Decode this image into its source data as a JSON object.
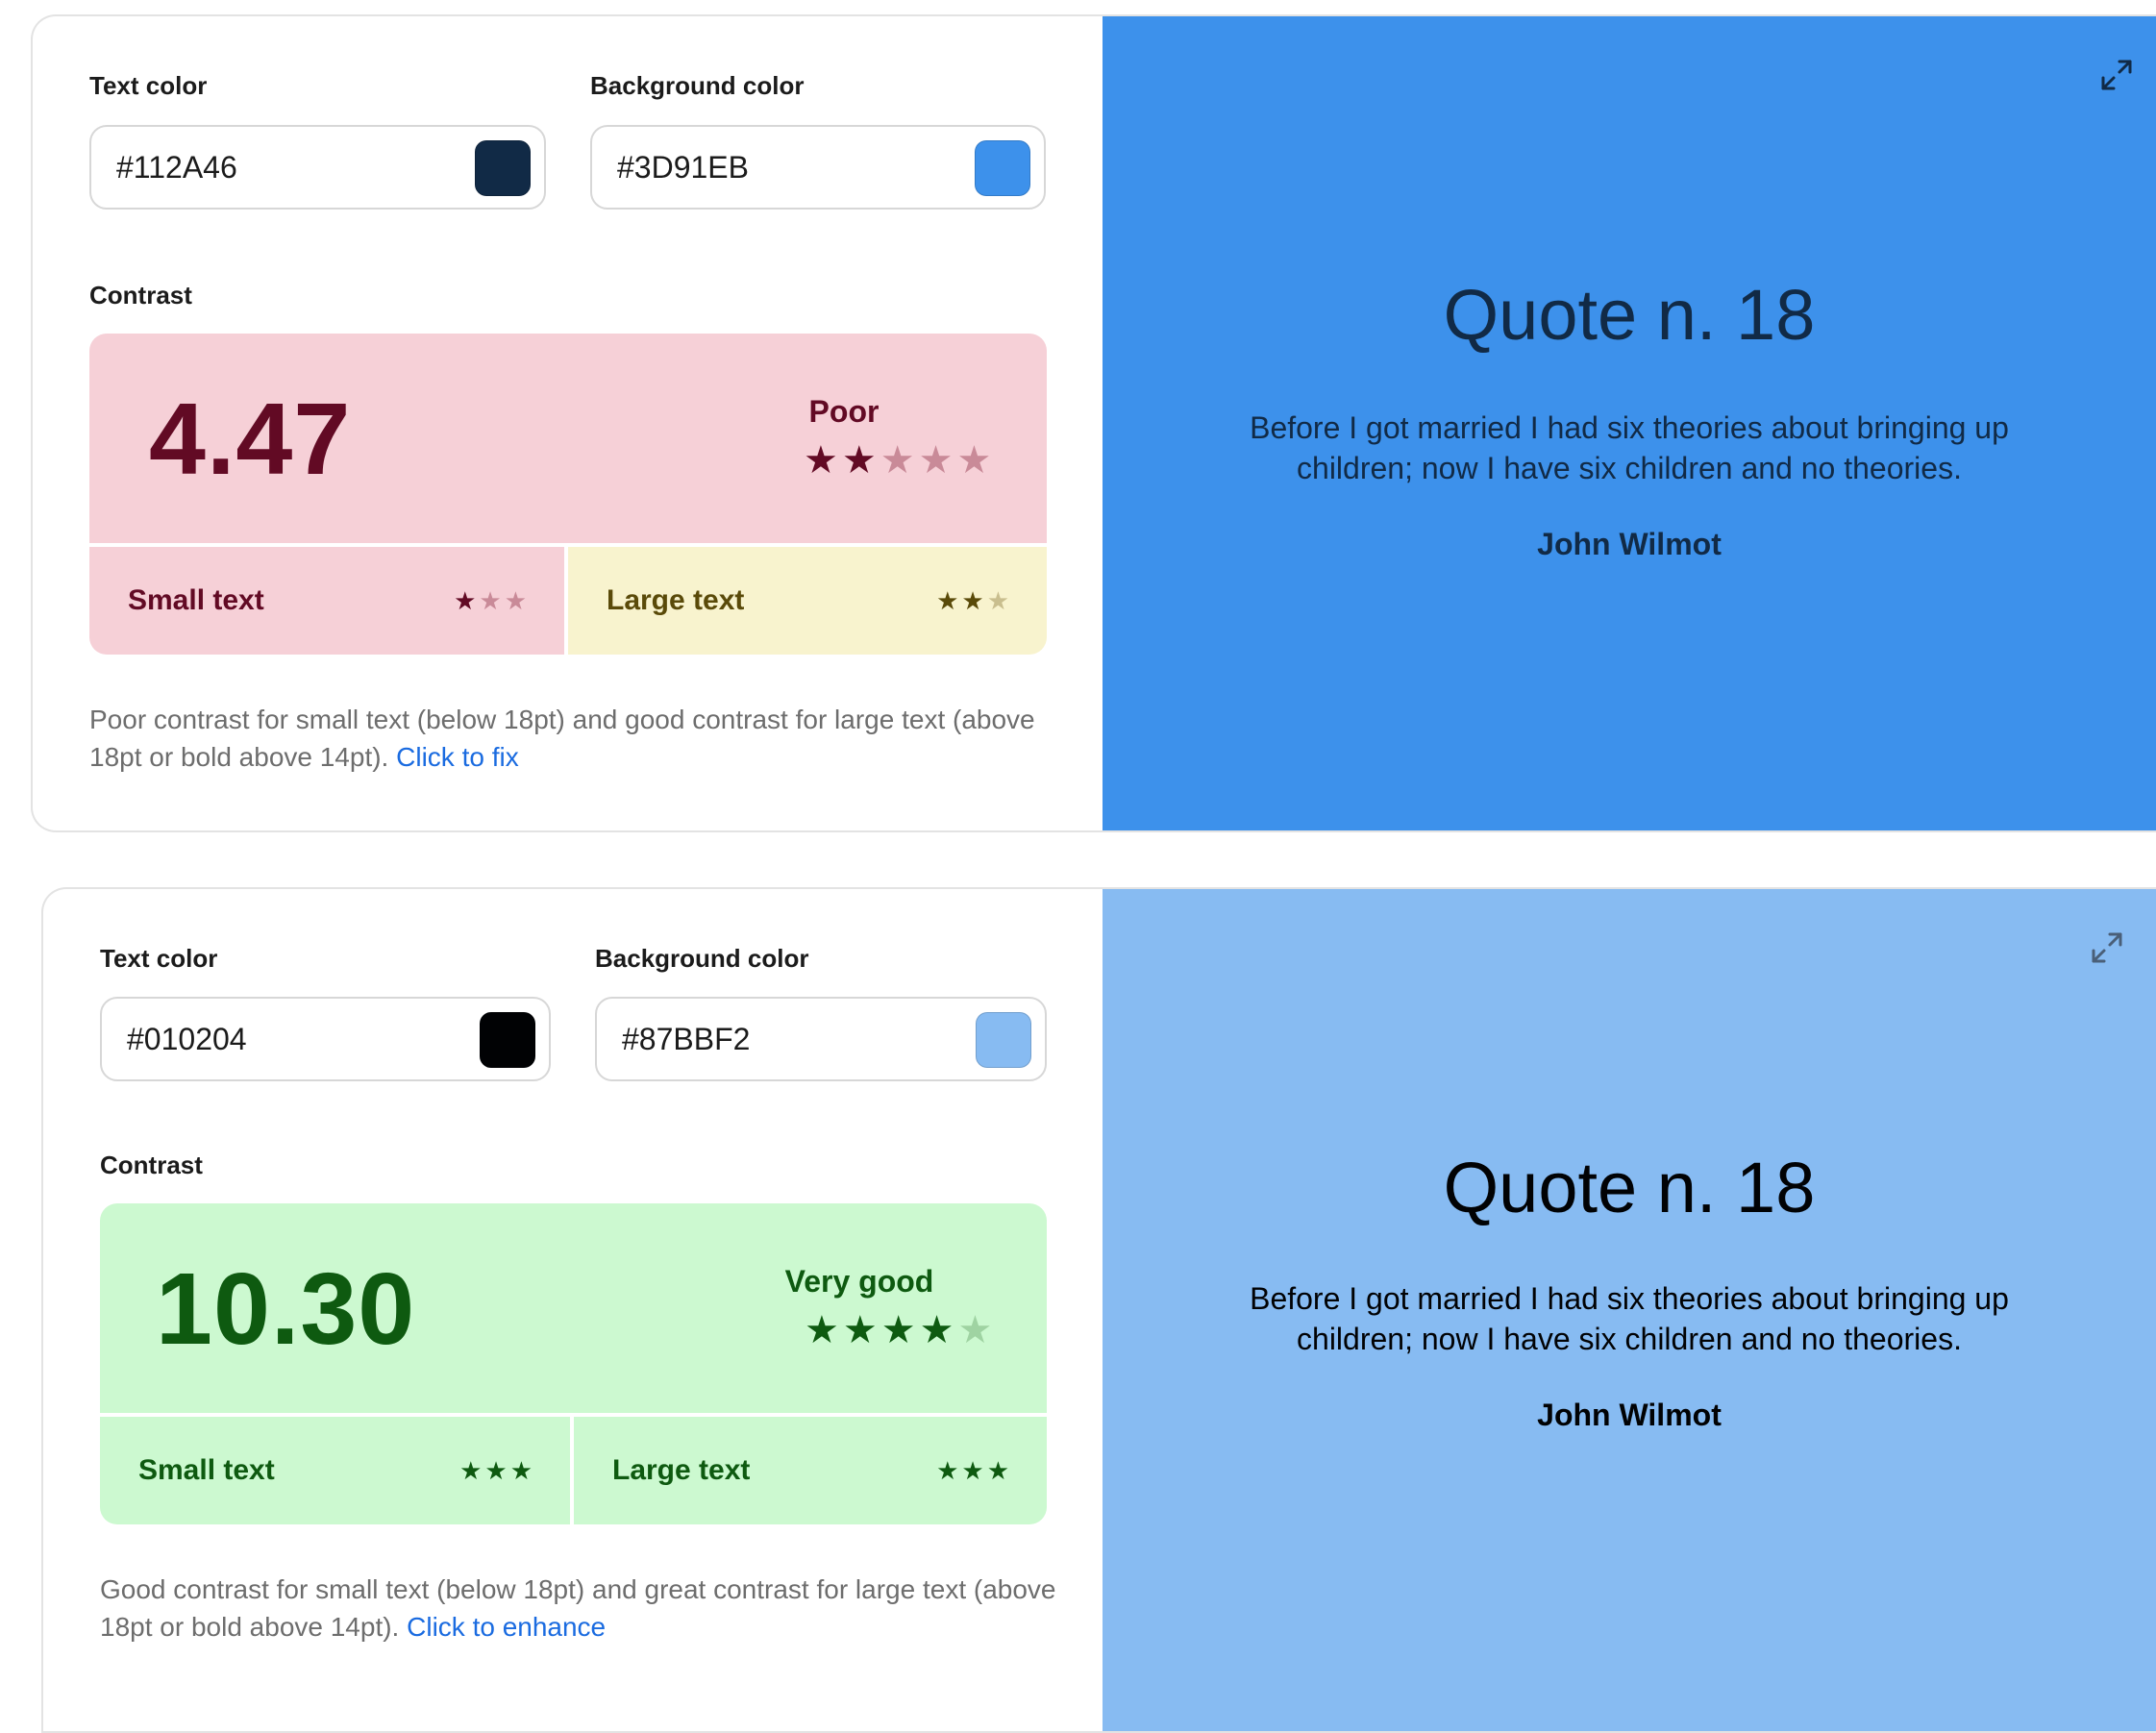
{
  "cards": [
    {
      "text_color_label": "Text color",
      "bg_color_label": "Background color",
      "text_color": "#112A46",
      "bg_color": "#3D91EB",
      "contrast_label": "Contrast",
      "ratio": "4.47",
      "rating": "Poor",
      "rating_stars": 2,
      "rating_stars_max": 5,
      "small_text_label": "Small text",
      "small_text_stars": 1,
      "large_text_label": "Large text",
      "large_text_stars": 2,
      "text_stars_max": 3,
      "description": "Poor contrast for small text (below 18pt) and good contrast for large text (above 18pt or bold above 14pt).",
      "fix_link": "Click to fix",
      "quote_title": "Quote n. 18",
      "quote_text": "Before I got married I had six theories about bringing up children; now I have six children and no theories.",
      "quote_author": "John Wilmot",
      "panel_colors": {
        "bg": "#F6D0D7",
        "fg": "#620A24",
        "dim": "#C98A98",
        "large_bg": "#F8F3CE",
        "large_fg": "#5A4A09",
        "large_dim": "#C9BE8E"
      }
    },
    {
      "text_color_label": "Text color",
      "bg_color_label": "Background color",
      "text_color": "#010204",
      "bg_color": "#87BBF2",
      "contrast_label": "Contrast",
      "ratio": "10.30",
      "rating": "Very good",
      "rating_stars": 4,
      "rating_stars_max": 5,
      "small_text_label": "Small text",
      "small_text_stars": 3,
      "large_text_label": "Large text",
      "large_text_stars": 3,
      "text_stars_max": 3,
      "description": "Good contrast for small text (below 18pt) and great contrast for large text (above 18pt or bold above 14pt).",
      "fix_link": "Click to enhance",
      "quote_title": "Quote n. 18",
      "quote_text": "Before I got married I had six theories about bringing up children; now I have six children and no theories.",
      "quote_author": "John Wilmot",
      "panel_colors": {
        "bg": "#CCF9D0",
        "fg": "#0E5A10",
        "dim": "#9FD3A2",
        "large_bg": "#CCF9D0",
        "large_fg": "#0E5A10",
        "large_dim": "#9FD3A2"
      }
    }
  ]
}
